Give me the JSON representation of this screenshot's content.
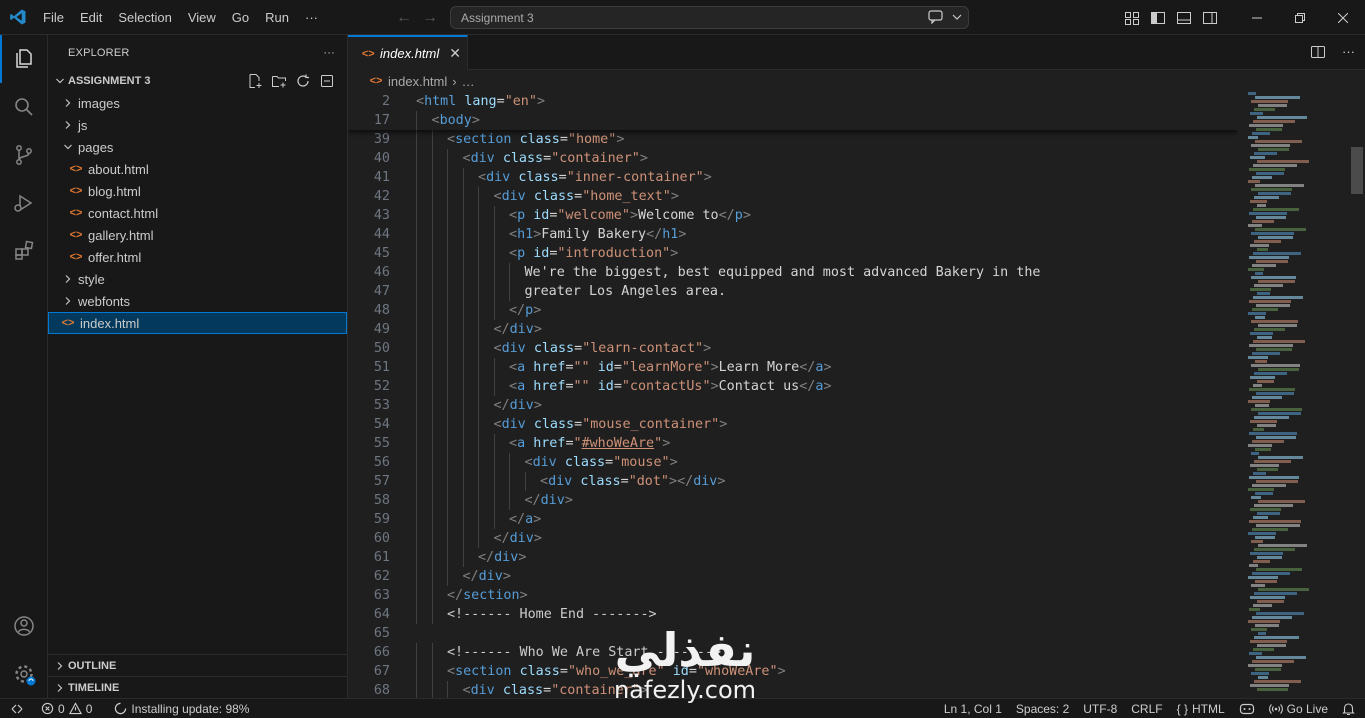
{
  "titlebar": {
    "menu": [
      "File",
      "Edit",
      "Selection",
      "View",
      "Go",
      "Run",
      "···"
    ],
    "command_center": "Assignment 3"
  },
  "explorer": {
    "header": "EXPLORER",
    "more": "···",
    "project": "ASSIGNMENT 3",
    "tree": [
      {
        "label": "images",
        "type": "folder",
        "depth": 0,
        "expanded": false
      },
      {
        "label": "js",
        "type": "folder",
        "depth": 0,
        "expanded": false
      },
      {
        "label": "pages",
        "type": "folder",
        "depth": 0,
        "expanded": true
      },
      {
        "label": "about.html",
        "type": "html",
        "depth": 1
      },
      {
        "label": "blog.html",
        "type": "html",
        "depth": 1
      },
      {
        "label": "contact.html",
        "type": "html",
        "depth": 1
      },
      {
        "label": "gallery.html",
        "type": "html",
        "depth": 1
      },
      {
        "label": "offer.html",
        "type": "html",
        "depth": 1
      },
      {
        "label": "style",
        "type": "folder",
        "depth": 0,
        "expanded": false
      },
      {
        "label": "webfonts",
        "type": "folder",
        "depth": 0,
        "expanded": false
      },
      {
        "label": "index.html",
        "type": "html",
        "depth": 0,
        "selected": true
      }
    ],
    "outline": "OUTLINE",
    "timeline": "TIMELINE"
  },
  "editor": {
    "tab": "index.html",
    "tab_close": "✕",
    "breadcrumb_file": "index.html",
    "breadcrumb_rest": "…",
    "sticky": [
      {
        "n": "2",
        "indent": 0,
        "html": "<span class='t'>&lt;</span><span class='tg'>html</span> <span class='at'>lang</span><span class='t'>=</span><span class='sv'>\"en\"</span><span class='t'>&gt;</span>"
      },
      {
        "n": "17",
        "indent": 1,
        "html": "<span class='t'>&lt;</span><span class='tg'>body</span><span class='t'>&gt;</span>"
      }
    ],
    "lines": [
      {
        "n": "39",
        "indent": 2,
        "code": "<section class=\"home\">"
      },
      {
        "n": "40",
        "indent": 3,
        "code": "<div class=\"container\">"
      },
      {
        "n": "41",
        "indent": 4,
        "code": "<div class=\"inner-container\">"
      },
      {
        "n": "42",
        "indent": 5,
        "code": "<div class=\"home_text\">"
      },
      {
        "n": "43",
        "indent": 6,
        "code": "<p id=\"welcome\">Welcome to</p>"
      },
      {
        "n": "44",
        "indent": 6,
        "code": "<h1>Family Bakery</h1>"
      },
      {
        "n": "45",
        "indent": 6,
        "code": "<p id=\"introduction\">"
      },
      {
        "n": "46",
        "indent": 7,
        "code": "We're the biggest, best equipped and most advanced Bakery in the"
      },
      {
        "n": "47",
        "indent": 7,
        "code": "greater Los Angeles area."
      },
      {
        "n": "48",
        "indent": 6,
        "code": "</p>"
      },
      {
        "n": "49",
        "indent": 5,
        "code": "</div>"
      },
      {
        "n": "50",
        "indent": 5,
        "code": "<div class=\"learn-contact\">"
      },
      {
        "n": "51",
        "indent": 6,
        "code": "<a href=\"\" id=\"learnMore\">Learn More</a>"
      },
      {
        "n": "52",
        "indent": 6,
        "code": "<a href=\"\" id=\"contactUs\">Contact us</a>"
      },
      {
        "n": "53",
        "indent": 5,
        "code": "</div>"
      },
      {
        "n": "54",
        "indent": 5,
        "code": "<div class=\"mouse_container\">"
      },
      {
        "n": "55",
        "indent": 6,
        "code": "<a href=\"#whoWeAre\">"
      },
      {
        "n": "56",
        "indent": 7,
        "code": "<div class=\"mouse\">"
      },
      {
        "n": "57",
        "indent": 8,
        "code": "<div class=\"dot\"></div>"
      },
      {
        "n": "58",
        "indent": 7,
        "code": "</div>"
      },
      {
        "n": "59",
        "indent": 6,
        "code": "</a>"
      },
      {
        "n": "60",
        "indent": 5,
        "code": "</div>"
      },
      {
        "n": "61",
        "indent": 4,
        "code": "</div>"
      },
      {
        "n": "62",
        "indent": 3,
        "code": "</div>"
      },
      {
        "n": "63",
        "indent": 2,
        "code": "</section>"
      },
      {
        "n": "64",
        "indent": 2,
        "code": "<!------ Home End ------->"
      },
      {
        "n": "65",
        "indent": 0,
        "code": ""
      },
      {
        "n": "66",
        "indent": 2,
        "code": "<!------ Who We Are Start ------->"
      },
      {
        "n": "67",
        "indent": 2,
        "code": "<section class=\"who_we_are\" id=\"whoWeAre\">"
      },
      {
        "n": "68",
        "indent": 3,
        "code": "<div class=\"container\">"
      }
    ]
  },
  "statusbar": {
    "errors": "0",
    "warnings": "0",
    "update": "Installing update: 98%",
    "position": "Ln 1, Col 1",
    "spaces": "Spaces: 2",
    "encoding": "UTF-8",
    "eol": "CRLF",
    "language": "HTML",
    "golive": "Go Live"
  },
  "watermark": {
    "arabic": "نفذلي",
    "latin": "nafezly.com"
  },
  "colors": {
    "accent": "#0078d4",
    "tag": "#569cd6",
    "attr": "#9cdcfe",
    "string": "#ce9178",
    "text": "#d4d4d4",
    "punct": "#808080",
    "comment": "#cccccc",
    "html_icon": "#e37933"
  }
}
